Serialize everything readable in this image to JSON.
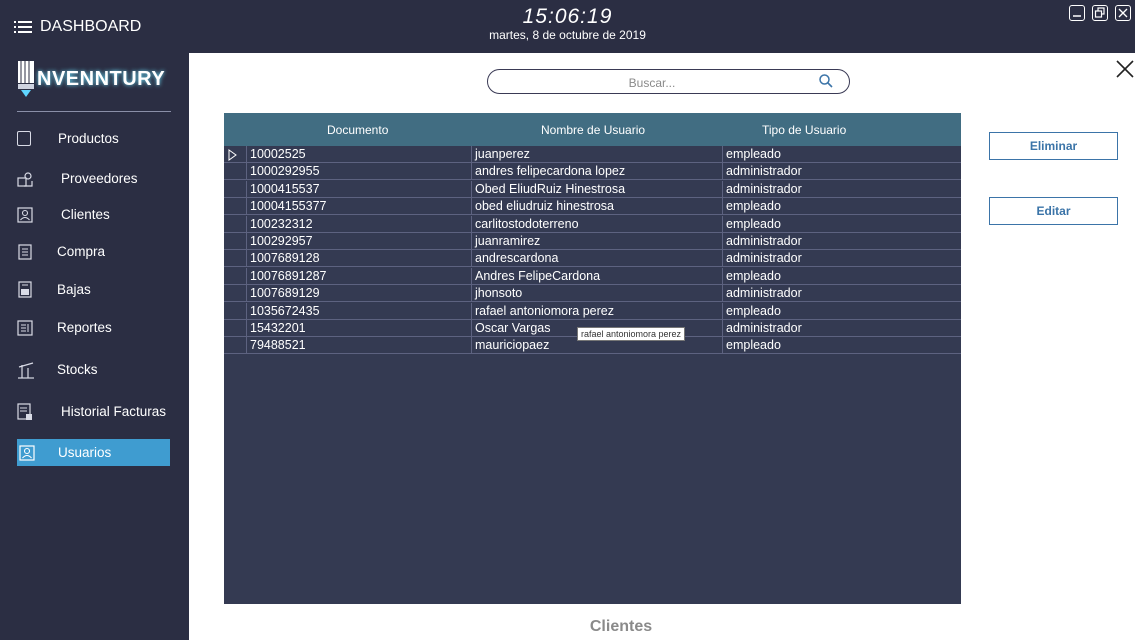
{
  "header": {
    "menu_label": "DASHBOARD",
    "time": "15:06:19",
    "date": "martes, 8 de octubre de 2019"
  },
  "logo": {
    "text": "NVENNTURY"
  },
  "sidebar": {
    "items": [
      {
        "label": "Productos",
        "icon": "product-icon"
      },
      {
        "label": "Proveedores",
        "icon": "supplier-icon"
      },
      {
        "label": "Clientes",
        "icon": "client-icon"
      },
      {
        "label": "Compra",
        "icon": "purchase-icon"
      },
      {
        "label": "Bajas",
        "icon": "write-off-icon"
      },
      {
        "label": "Reportes",
        "icon": "report-icon"
      },
      {
        "label": "Stocks",
        "icon": "stock-icon"
      },
      {
        "label": "Historial Facturas",
        "icon": "invoice-history-icon"
      },
      {
        "label": "Usuarios",
        "icon": "users-icon",
        "active": true
      }
    ]
  },
  "search": {
    "placeholder": "Buscar..."
  },
  "grid": {
    "columns": [
      "Documento",
      "Nombre de Usuario",
      "Tipo de Usuario"
    ],
    "rows": [
      {
        "documento": "10002525",
        "nombre": "juanperez",
        "tipo": "empleado"
      },
      {
        "documento": "1000292955",
        "nombre": "andres felipecardona lopez",
        "tipo": "administrador"
      },
      {
        "documento": "1000415537",
        "nombre": "Obed EliudRuiz Hinestrosa",
        "tipo": "administrador"
      },
      {
        "documento": "10004155377",
        "nombre": "obed eliudruiz hinestrosa",
        "tipo": "empleado"
      },
      {
        "documento": "100232312",
        "nombre": "carlitostodoterreno",
        "tipo": "empleado"
      },
      {
        "documento": "100292957",
        "nombre": "juanramirez",
        "tipo": "administrador"
      },
      {
        "documento": "1007689128",
        "nombre": "andrescardona",
        "tipo": "administrador"
      },
      {
        "documento": "10076891287",
        "nombre": "Andres FelipeCardona",
        "tipo": "empleado"
      },
      {
        "documento": "1007689129",
        "nombre": "jhonsoto",
        "tipo": "administrador"
      },
      {
        "documento": "1035672435",
        "nombre": "rafael antoniomora perez",
        "tipo": "empleado"
      },
      {
        "documento": "15432201",
        "nombre": "Oscar Vargas",
        "tipo": "administrador"
      },
      {
        "documento": "79488521",
        "nombre": "mauriciopaez",
        "tipo": "empleado"
      }
    ],
    "tooltip": "rafael antoniomora perez"
  },
  "actions": {
    "delete_label": "Eliminar",
    "edit_label": "Editar"
  },
  "footer": {
    "title": "Clientes"
  },
  "colors": {
    "sidebar_bg": "#2b2e43",
    "grid_bg": "#343a52",
    "grid_header": "#416d82",
    "active_item": "#3f9cd0",
    "button_text": "#3b74a8"
  }
}
